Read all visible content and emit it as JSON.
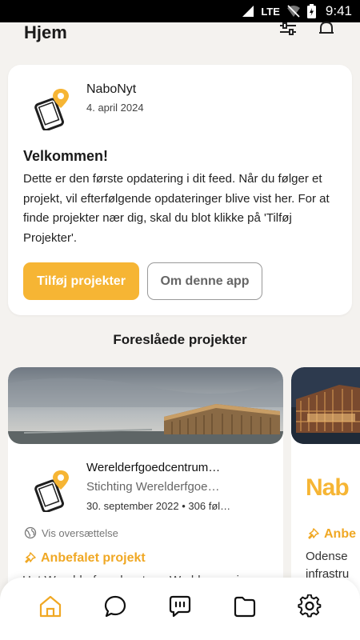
{
  "status_bar": {
    "network": "LTE",
    "time": "9:41"
  },
  "header": {
    "title": "Hjem",
    "icons": [
      "filter-sliders-icon",
      "bell-icon"
    ]
  },
  "welcome_card": {
    "source": "NaboNyt",
    "date": "4. april 2024",
    "title": "Velkommen!",
    "body": "Dette er den første opdatering i dit feed. Når du følger et projekt, vil efterfølgende opdateringer blive vist her. For at finde projekter nær dig, skal du blot klikke på 'Tilføj Projekter'.",
    "primary_button": "Tilføj projekter",
    "secondary_button": "Om denne app"
  },
  "suggested": {
    "title": "Foreslåede projekter",
    "projects": [
      {
        "name": "Werelderfgoedcentrum…",
        "org": "Stichting Werelderfgoe…",
        "meta": "30. september 2022 • 306 føl…",
        "translate": "Vis oversættelse",
        "badge": "Anbefalet projekt",
        "teaser": "Het Werelderfgoedcentrum Waddenzee is…"
      },
      {
        "brand": "Nab",
        "badge": "Anbe",
        "line1": "Odense",
        "line2": "infrastru"
      }
    ]
  },
  "bottom_nav": {
    "items": [
      "home-icon",
      "chat-bubble-icon",
      "message-dots-icon",
      "folder-icon",
      "settings-gear-icon"
    ]
  },
  "colors": {
    "accent": "#f6b534",
    "background": "#f4f2ef"
  }
}
